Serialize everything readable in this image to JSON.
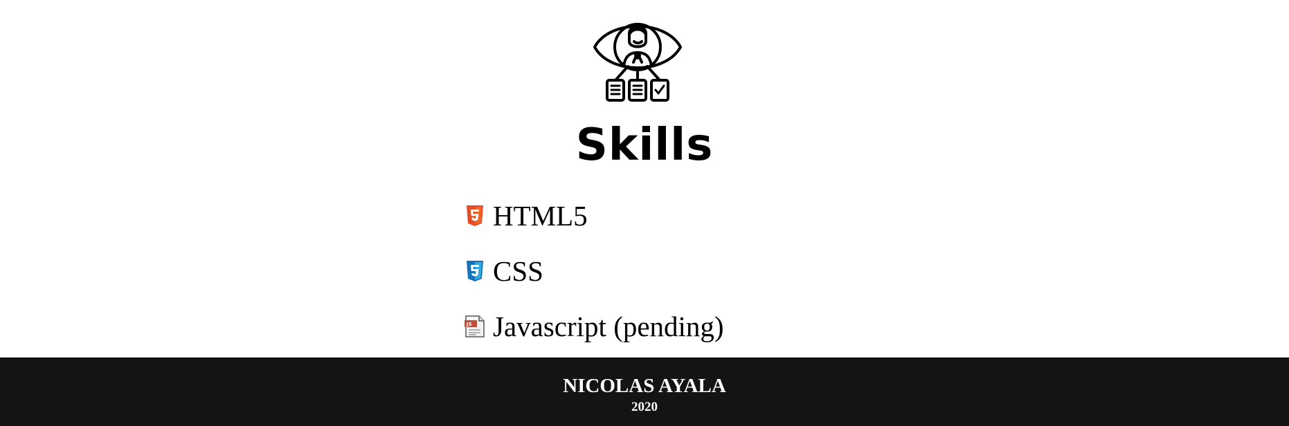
{
  "header": {
    "icon": "eye-person-documents-icon",
    "title": "Skills"
  },
  "skills": [
    {
      "label": "HTML5",
      "icon": "html5-icon",
      "color": "#e44d26"
    },
    {
      "label": "CSS",
      "icon": "css3-icon",
      "color": "#2196f3"
    },
    {
      "label": "Javascript (pending)",
      "icon": "js-file-icon",
      "color": "#c0503a"
    }
  ],
  "footer": {
    "name": "NICOLAS AYALA",
    "year": "2020",
    "background": "#141414"
  }
}
